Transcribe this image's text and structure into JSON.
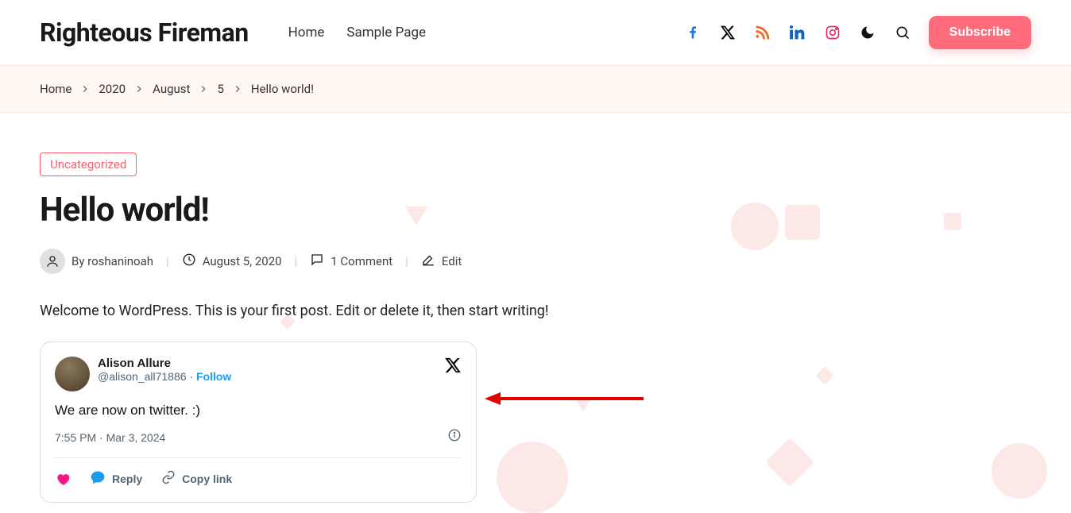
{
  "header": {
    "site_title": "Righteous Fireman",
    "nav": [
      "Home",
      "Sample Page"
    ],
    "subscribe": "Subscribe"
  },
  "breadcrumb": {
    "items": [
      "Home",
      "2020",
      "August",
      "5",
      "Hello world!"
    ]
  },
  "post": {
    "category": "Uncategorized",
    "title": "Hello world!",
    "by_prefix": "By ",
    "author": "roshaninoah",
    "date": "August 5, 2020",
    "comments": "1 Comment",
    "edit": "Edit",
    "body": "Welcome to WordPress. This is your first post. Edit or delete it, then start writing!"
  },
  "tweet": {
    "name": "Alison Allure",
    "handle": "@alison_all71886",
    "follow": "Follow",
    "text": "We are now on twitter. :)",
    "date": "7:55 PM · Mar 3, 2024",
    "reply": "Reply",
    "copy": "Copy link"
  },
  "colors": {
    "accent": "#ff6b7a",
    "facebook": "#1877f2",
    "rss": "#f26522",
    "linkedin": "#0a66c2",
    "instagram": "#e1306c"
  }
}
